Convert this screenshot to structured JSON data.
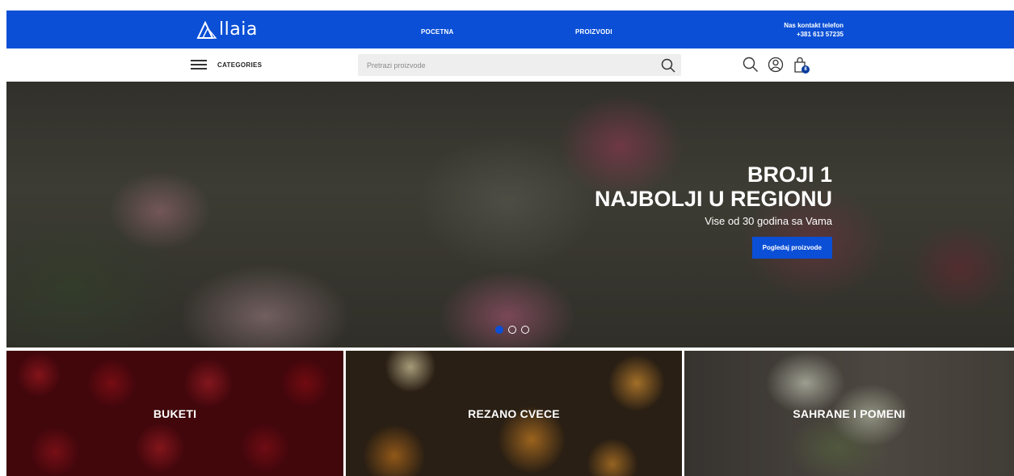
{
  "header": {
    "logo_text": "llaia",
    "nav": {
      "home": "POCETNA",
      "products": "PROIZVODI"
    },
    "contact": {
      "label": "Nas kontakt telefon",
      "phone": "+381 613 57235"
    }
  },
  "subbar": {
    "categories_label": "CATEGORIES",
    "search_placeholder": "Pretrazi proizvode",
    "cart_count": "8"
  },
  "hero": {
    "title_line1": "BROJI 1",
    "title_line2": "NAJBOLJI U REGIONU",
    "subtitle": "Vise od 30 godina sa Vama",
    "cta": "Pogledaj proizvode",
    "slides": 3,
    "active_slide": 1
  },
  "tiles": [
    {
      "label": "BUKETI"
    },
    {
      "label": "REZANO CVECE"
    },
    {
      "label": "SAHRANE I POMENI"
    }
  ],
  "colors": {
    "brand_blue": "#0a4fd6",
    "badge_blue": "#0a3c9e"
  },
  "icons": [
    "menu-icon",
    "search-icon",
    "user-icon",
    "shopping-bag-icon"
  ]
}
